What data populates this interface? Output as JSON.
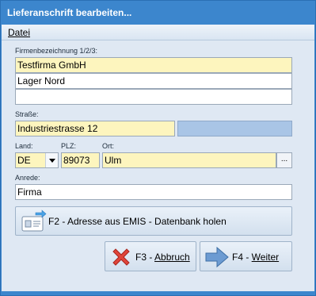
{
  "window": {
    "title": "Lieferanschrift bearbeiten...",
    "accent_color": "#3c86cd"
  },
  "menu": {
    "items": [
      {
        "label": "Datei",
        "icon": "none"
      }
    ]
  },
  "form": {
    "company_label": "Firmenbezeichnung 1/2/3:",
    "company_line1": "Testfirma GmbH",
    "company_line2": "Lager Nord",
    "company_line3": "",
    "street_label": "Straße:",
    "street_value": "Industriestrasse 12",
    "street_extra": "",
    "country_label": "Land:",
    "country_value": "DE",
    "zip_label": "PLZ:",
    "zip_value": "89073",
    "city_label": "Ort:",
    "city_value": "Ulm",
    "city_button": "...",
    "salutation_label": "Anrede:",
    "salutation_value": "Firma",
    "highlight_color": "#fdf5be"
  },
  "actions": {
    "emis_button": "F2 - Adresse aus EMIS - Datenbank holen",
    "cancel_button_key": "F3 - ",
    "cancel_button_text": "Abbruch",
    "next_button_key": "F4 - ",
    "next_button_text": "Weiter",
    "icons": [
      "address-card-icon",
      "red-x-icon",
      "right-arrow-icon"
    ]
  }
}
